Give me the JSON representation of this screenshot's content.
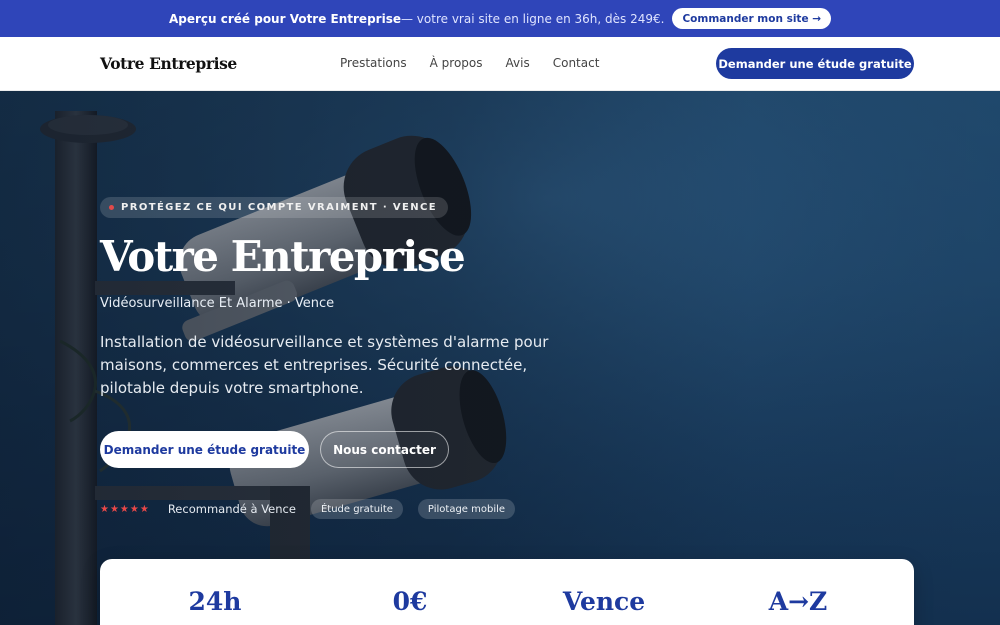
{
  "banner": {
    "lead": "Aperçu créé pour Votre Entreprise",
    "rest": " — votre vrai site en ligne en 36h, dès 249€.",
    "cta": "Commander mon site →"
  },
  "header": {
    "logo": "Votre Entreprise",
    "nav": [
      "Prestations",
      "À propos",
      "Avis",
      "Contact"
    ],
    "cta": "Demander une étude gratuite"
  },
  "hero": {
    "eyebrow": "PROTÉGEZ CE QUI COMPTE VRAIMENT · VENCE",
    "title": "Votre Entreprise",
    "subtitle": "Vidéosurveillance Et Alarme · Vence",
    "description": "Installation de vidéosurveillance et systèmes d'alarme pour maisons, commerces et entreprises. Sécurité connectée, pilotable depuis votre smartphone.",
    "primary_cta": "Demander une étude gratuite",
    "secondary_cta": "Nous contacter",
    "stars": "★★★★★",
    "rating": 5,
    "trust_text": "Recommandé à Vence",
    "chips": [
      "Étude gratuite",
      "Pilotage mobile"
    ]
  },
  "stats": [
    "24h",
    "0€",
    "Vence",
    "A→Z"
  ],
  "colors": {
    "brand": "#1e3a9f",
    "banner": "#2f45b9",
    "star": "#e84848"
  }
}
